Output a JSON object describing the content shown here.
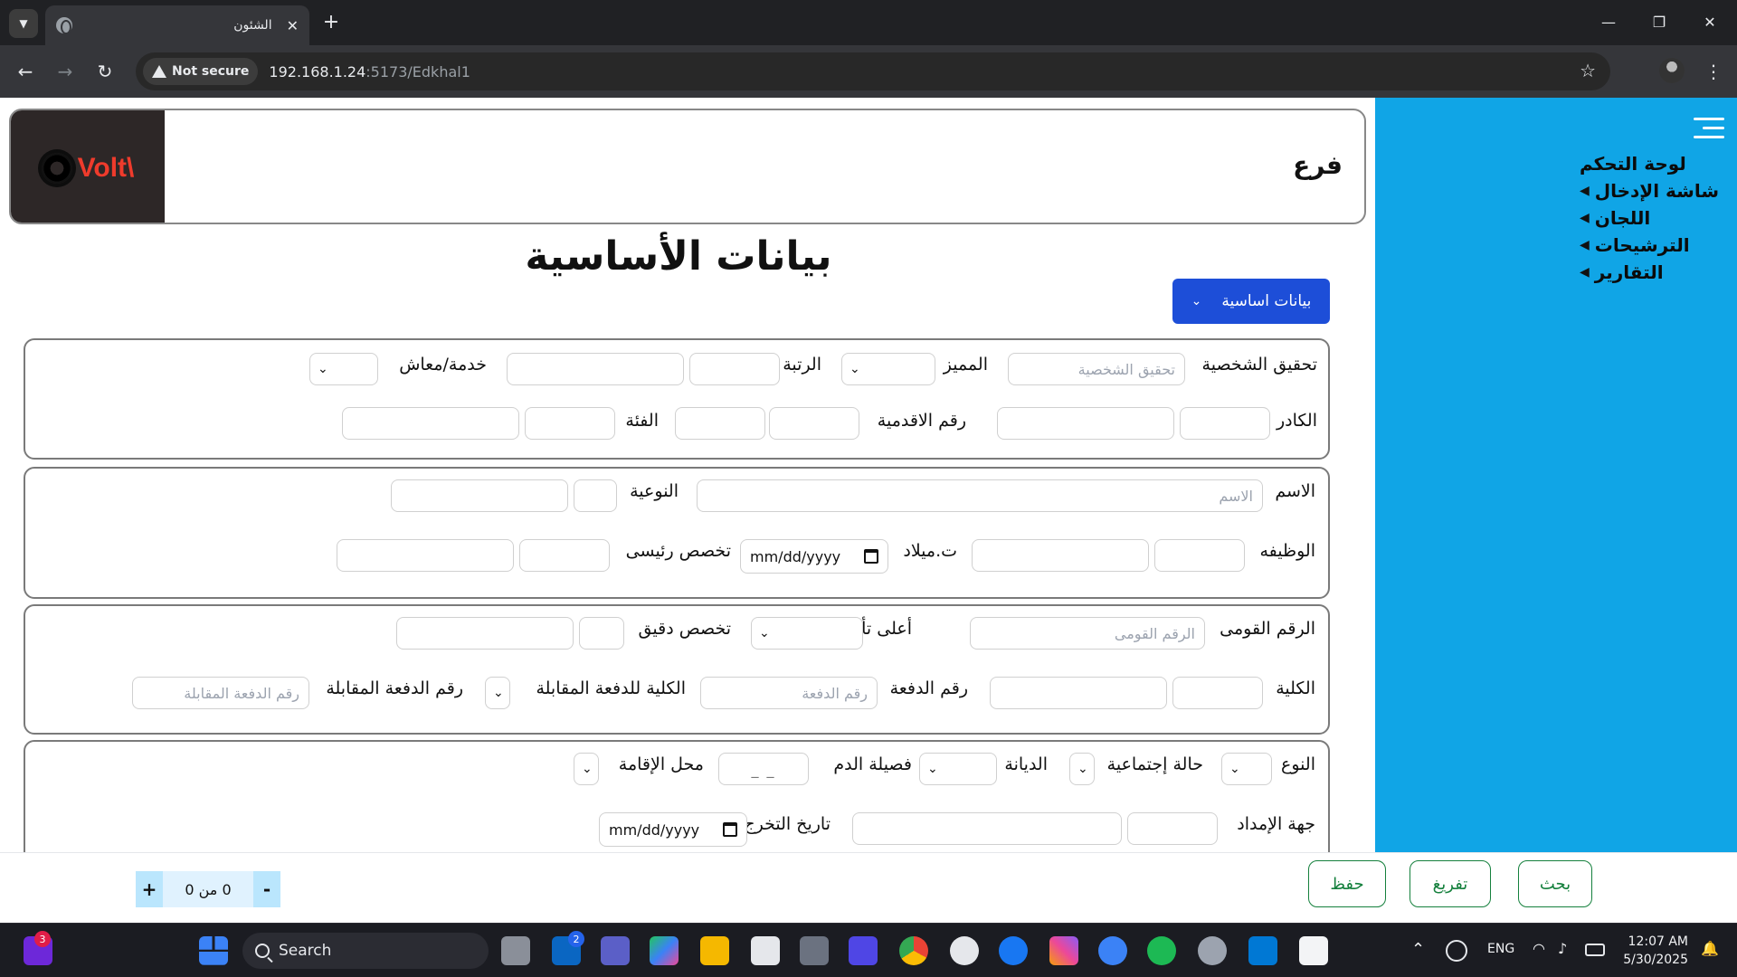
{
  "browser": {
    "tab_title": "الشئون",
    "security_label": "Not secure",
    "url_host": "192.168.1.24",
    "url_path": ":5173/Edkhal1"
  },
  "sidebar": {
    "items": [
      {
        "label": "لوحة التحكم",
        "has_arrow": false
      },
      {
        "label": "شاشة الإدخال",
        "has_arrow": true
      },
      {
        "label": "اللجان",
        "has_arrow": true
      },
      {
        "label": "الترشيحات",
        "has_arrow": true
      },
      {
        "label": "التقارير",
        "has_arrow": true
      }
    ]
  },
  "header": {
    "title": "فرع",
    "logo_text": "Volt\\"
  },
  "page": {
    "title": "بيانات الأساسية",
    "section_select": "بيانات اساسية"
  },
  "form": {
    "s1": {
      "id_check": "تحقيق الشخصية",
      "id_check_ph": "تحقيق الشخصية",
      "distinguished": "المميز",
      "rank": "الرتبة",
      "service": "خدمة/معاش",
      "cadre": "الكادر",
      "seniority": "رقم الاقدمية",
      "category": "الفئة"
    },
    "s2": {
      "name": "الاسم",
      "name_ph": "الاسم",
      "type": "النوعية",
      "job": "الوظيفه",
      "birth": "ت.ميلاد",
      "date_ph": "mm/dd/yyyy",
      "main_spec": "تخصص رئيسى"
    },
    "s3": {
      "national_id": "الرقم القومى",
      "national_id_ph": "الرقم القومى",
      "qualification": "أعلى تأهيل",
      "sub_spec": "تخصص دقيق",
      "college": "الكلية",
      "batch": "رقم الدفعة",
      "batch_ph": "رقم الدفعة",
      "college_match": "الكلية للدفعة المقابلة",
      "batch_match": "رقم الدفعة المقابلة",
      "batch_match_ph": "رقم الدفعة المقابلة"
    },
    "s4": {
      "gender": "النوع",
      "marital": "حالة إجتماعية",
      "religion": "الديانة",
      "blood": "فصيلة الدم",
      "blood_ph": "_ _",
      "residence": "محل الإقامة",
      "supply": "جهة الإمداد",
      "grad_date": "تاريخ التخرج",
      "date_ph": "mm/dd/yyyy"
    }
  },
  "footer": {
    "search_btn": "بحث",
    "clear_btn": "تفريغ",
    "save_btn": "حفظ",
    "pager_text": "0 من 0",
    "pager_minus": "-",
    "pager_plus": "+"
  },
  "taskbar": {
    "search_label": "Search",
    "lang": "ENG",
    "time": "12:07 AM",
    "date": "5/30/2025",
    "badge_left": "3",
    "badge_linkedin": "2"
  }
}
